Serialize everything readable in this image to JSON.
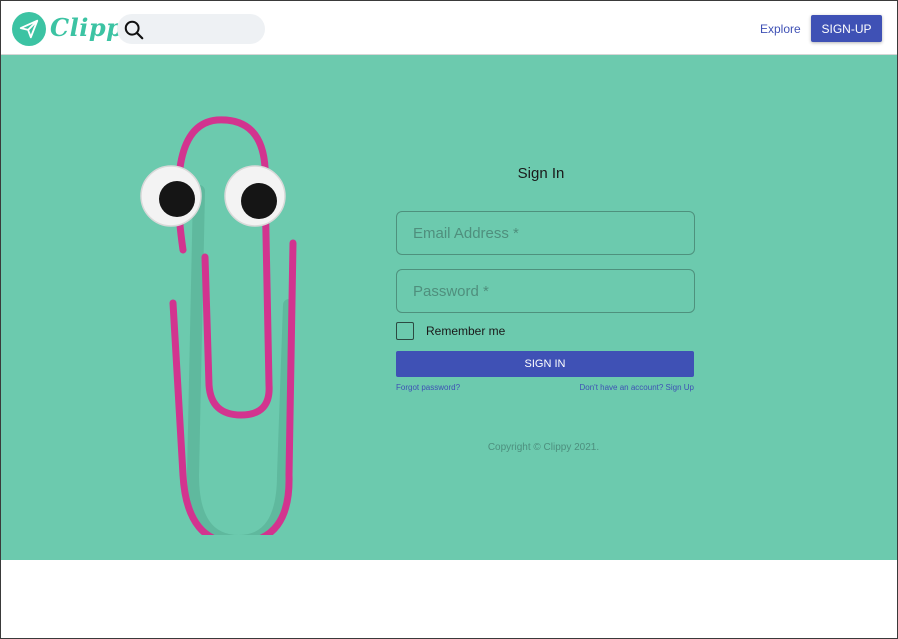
{
  "header": {
    "brand": "Clippy",
    "search": {
      "value": "",
      "placeholder": ""
    },
    "explore_label": "Explore",
    "signup_label": "SIGN-UP"
  },
  "hero": {
    "image": "googly-eyed-paperclip"
  },
  "form": {
    "title": "Sign In",
    "email_placeholder": "Email Address *",
    "password_placeholder": "Password *",
    "remember_label": "Remember me",
    "remember_checked": false,
    "signin_label": "SIGN IN",
    "forgot_label": "Forgot password?",
    "no_account_label": "Don't have an account? Sign Up",
    "copyright": "Copyright © Clippy 2021."
  },
  "colors": {
    "accent": "#3f51b5",
    "brand": "#3cc3a3",
    "hero_background": "#6ccaae",
    "paperclip": "#d2348f"
  },
  "icons": [
    "paper-plane-icon",
    "search-icon"
  ]
}
